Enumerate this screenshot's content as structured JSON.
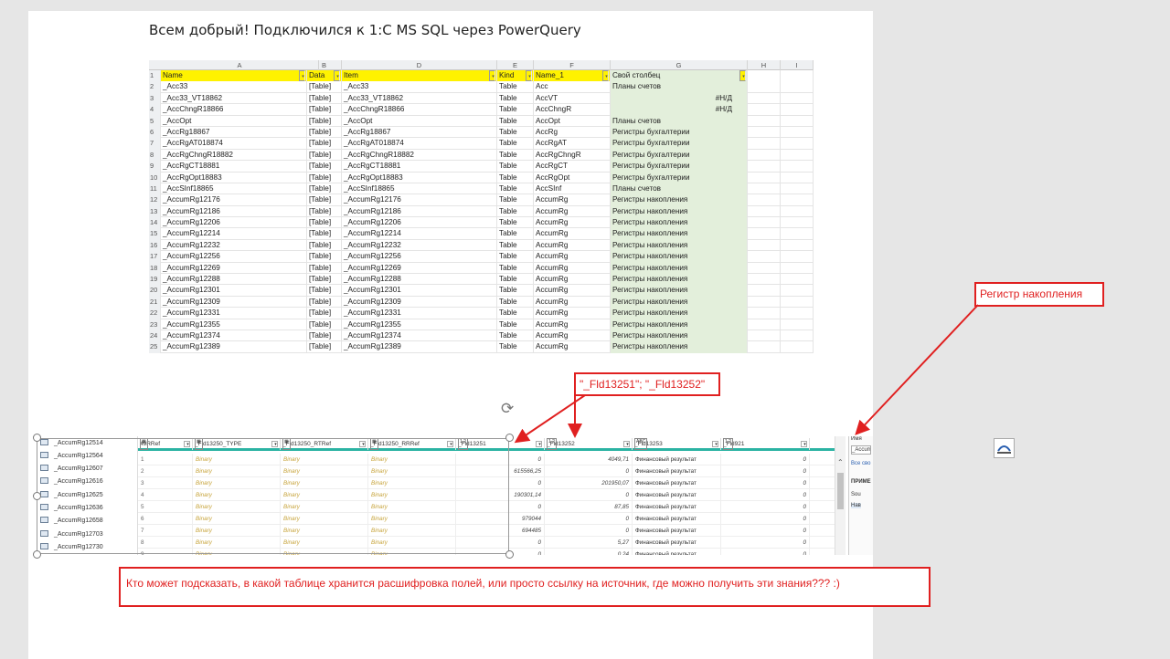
{
  "document": {
    "heading": "Всем добрый! Подключился к 1:С MS SQL через PowerQuery"
  },
  "excel": {
    "columns": [
      "A",
      "B",
      "D",
      "E",
      "F",
      "G",
      "H",
      "I"
    ],
    "header": {
      "row_no": "1",
      "name": "Name",
      "data": "Data",
      "item": "Item",
      "kind": "Kind",
      "name1": "Name_1",
      "custom": "Свой столбец"
    },
    "rows": [
      {
        "n": "2",
        "name": "_Acc33",
        "data": "[Table]",
        "item": "_Acc33",
        "kind": "Table",
        "name1": "Acc",
        "custom": "Планы счетов"
      },
      {
        "n": "3",
        "name": "_Acc33_VT18862",
        "data": "[Table]",
        "item": "_Acc33_VT18862",
        "kind": "Table",
        "name1": "AccVT",
        "custom": "#Н/Д"
      },
      {
        "n": "4",
        "name": "_AccChngR18866",
        "data": "[Table]",
        "item": "_AccChngR18866",
        "kind": "Table",
        "name1": "AccChngR",
        "custom": "#Н/Д"
      },
      {
        "n": "5",
        "name": "_AccOpt",
        "data": "[Table]",
        "item": "_AccOpt",
        "kind": "Table",
        "name1": "AccOpt",
        "custom": "Планы счетов"
      },
      {
        "n": "6",
        "name": "_AccRg18867",
        "data": "[Table]",
        "item": "_AccRg18867",
        "kind": "Table",
        "name1": "AccRg",
        "custom": "Регистры бухгалтерии"
      },
      {
        "n": "7",
        "name": "_AccRgAT018874",
        "data": "[Table]",
        "item": "_AccRgAT018874",
        "kind": "Table",
        "name1": "AccRgAT",
        "custom": "Регистры бухгалтерии"
      },
      {
        "n": "8",
        "name": "_AccRgChngR18882",
        "data": "[Table]",
        "item": "_AccRgChngR18882",
        "kind": "Table",
        "name1": "AccRgChngR",
        "custom": "Регистры бухгалтерии"
      },
      {
        "n": "9",
        "name": "_AccRgCT18881",
        "data": "[Table]",
        "item": "_AccRgCT18881",
        "kind": "Table",
        "name1": "AccRgCT",
        "custom": "Регистры бухгалтерии"
      },
      {
        "n": "10",
        "name": "_AccRgOpt18883",
        "data": "[Table]",
        "item": "_AccRgOpt18883",
        "kind": "Table",
        "name1": "AccRgOpt",
        "custom": "Регистры бухгалтерии"
      },
      {
        "n": "11",
        "name": "_AccSInf18865",
        "data": "[Table]",
        "item": "_AccSInf18865",
        "kind": "Table",
        "name1": "AccSInf",
        "custom": "Планы счетов"
      },
      {
        "n": "12",
        "name": "_AccumRg12176",
        "data": "[Table]",
        "item": "_AccumRg12176",
        "kind": "Table",
        "name1": "AccumRg",
        "custom": "Регистры накопления"
      },
      {
        "n": "13",
        "name": "_AccumRg12186",
        "data": "[Table]",
        "item": "_AccumRg12186",
        "kind": "Table",
        "name1": "AccumRg",
        "custom": "Регистры накопления"
      },
      {
        "n": "14",
        "name": "_AccumRg12206",
        "data": "[Table]",
        "item": "_AccumRg12206",
        "kind": "Table",
        "name1": "AccumRg",
        "custom": "Регистры накопления"
      },
      {
        "n": "15",
        "name": "_AccumRg12214",
        "data": "[Table]",
        "item": "_AccumRg12214",
        "kind": "Table",
        "name1": "AccumRg",
        "custom": "Регистры накопления"
      },
      {
        "n": "16",
        "name": "_AccumRg12232",
        "data": "[Table]",
        "item": "_AccumRg12232",
        "kind": "Table",
        "name1": "AccumRg",
        "custom": "Регистры накопления"
      },
      {
        "n": "17",
        "name": "_AccumRg12256",
        "data": "[Table]",
        "item": "_AccumRg12256",
        "kind": "Table",
        "name1": "AccumRg",
        "custom": "Регистры накопления"
      },
      {
        "n": "18",
        "name": "_AccumRg12269",
        "data": "[Table]",
        "item": "_AccumRg12269",
        "kind": "Table",
        "name1": "AccumRg",
        "custom": "Регистры накопления"
      },
      {
        "n": "19",
        "name": "_AccumRg12288",
        "data": "[Table]",
        "item": "_AccumRg12288",
        "kind": "Table",
        "name1": "AccumRg",
        "custom": "Регистры накопления"
      },
      {
        "n": "20",
        "name": "_AccumRg12301",
        "data": "[Table]",
        "item": "_AccumRg12301",
        "kind": "Table",
        "name1": "AccumRg",
        "custom": "Регистры накопления"
      },
      {
        "n": "21",
        "name": "_AccumRg12309",
        "data": "[Table]",
        "item": "_AccumRg12309",
        "kind": "Table",
        "name1": "AccumRg",
        "custom": "Регистры накопления"
      },
      {
        "n": "22",
        "name": "_AccumRg12331",
        "data": "[Table]",
        "item": "_AccumRg12331",
        "kind": "Table",
        "name1": "AccumRg",
        "custom": "Регистры накопления"
      },
      {
        "n": "23",
        "name": "_AccumRg12355",
        "data": "[Table]",
        "item": "_AccumRg12355",
        "kind": "Table",
        "name1": "AccumRg",
        "custom": "Регистры накопления"
      },
      {
        "n": "24",
        "name": "_AccumRg12374",
        "data": "[Table]",
        "item": "_AccumRg12374",
        "kind": "Table",
        "name1": "AccumRg",
        "custom": "Регистры накопления"
      },
      {
        "n": "25",
        "name": "_AccumRg12389",
        "data": "[Table]",
        "item": "_AccumRg12389",
        "kind": "Table",
        "name1": "AccumRg",
        "custom": "Регистры накопления"
      }
    ]
  },
  "powerquery": {
    "queries": [
      "_AccumRg12514",
      "_AccumRg12564",
      "_AccumRg12607",
      "_AccumRg12616",
      "_AccumRg12625",
      "_AccumRg12636",
      "_AccumRg12658",
      "_AccumRg12703",
      "_AccumRg12730"
    ],
    "columns": [
      {
        "type": "",
        "label": "49RRef"
      },
      {
        "type": "",
        "label": "_Fld13250_TYPE"
      },
      {
        "type": "",
        "label": "_Fld13250_RTRef"
      },
      {
        "type": "",
        "label": "_Fld13250_RRRef"
      },
      {
        "type": "1.2",
        "label": "_Fld13251"
      },
      {
        "type": "1.2",
        "label": "_Fld13252"
      },
      {
        "type": "ABC",
        "label": "_Fld13253"
      },
      {
        "type": "1.2",
        "label": "_Fld921"
      }
    ],
    "rows": [
      {
        "n": "1",
        "b1": "Binary",
        "b2": "Binary",
        "b3": "Binary",
        "f51": "0",
        "f52": "4049,71",
        "f53": "Финансовый результат",
        "f921": "0"
      },
      {
        "n": "2",
        "b1": "Binary",
        "b2": "Binary",
        "b3": "Binary",
        "f51": "615566,25",
        "f52": "0",
        "f53": "Финансовый результат",
        "f921": "0"
      },
      {
        "n": "3",
        "b1": "Binary",
        "b2": "Binary",
        "b3": "Binary",
        "f51": "0",
        "f52": "201950,07",
        "f53": "Финансовый результат",
        "f921": "0"
      },
      {
        "n": "4",
        "b1": "Binary",
        "b2": "Binary",
        "b3": "Binary",
        "f51": "190301,14",
        "f52": "0",
        "f53": "Финансовый результат",
        "f921": "0"
      },
      {
        "n": "5",
        "b1": "Binary",
        "b2": "Binary",
        "b3": "Binary",
        "f51": "0",
        "f52": "87,85",
        "f53": "Финансовый результат",
        "f921": "0"
      },
      {
        "n": "6",
        "b1": "Binary",
        "b2": "Binary",
        "b3": "Binary",
        "f51": "979044",
        "f52": "0",
        "f53": "Финансовый результат",
        "f921": "0"
      },
      {
        "n": "7",
        "b1": "Binary",
        "b2": "Binary",
        "b3": "Binary",
        "f51": "694485",
        "f52": "0",
        "f53": "Финансовый результат",
        "f921": "0"
      },
      {
        "n": "8",
        "b1": "Binary",
        "b2": "Binary",
        "b3": "Binary",
        "f51": "0",
        "f52": "5,27",
        "f53": "Финансовый результат",
        "f921": "0"
      },
      {
        "n": "9",
        "b1": "Binary",
        "b2": "Binary",
        "b3": "Binary",
        "f51": "0",
        "f52": "0,24",
        "f53": "Финансовый результат",
        "f921": "0"
      }
    ],
    "side_panel": {
      "name_label": "Имя",
      "name_value": "_Accum",
      "all_props": "Все сво",
      "applied_steps": "ПРИМЕ",
      "step1": "Sou",
      "step2": "Нав"
    }
  },
  "callouts": {
    "register": "Регистр накопления",
    "fields": "\"_Fld13251\"; \"_Fld13252\"",
    "question": "Кто может подсказать, в какой таблице хранится расшифровка полей, или просто ссылку на источник, где можно получить эти знания??? :)"
  },
  "colors": {
    "highlight_yellow": "#fff200",
    "custom_col_green": "#e3efdb",
    "callout_red": "#e02020",
    "pq_accent": "#2bb3a3",
    "binary_text": "#c7a43b"
  }
}
